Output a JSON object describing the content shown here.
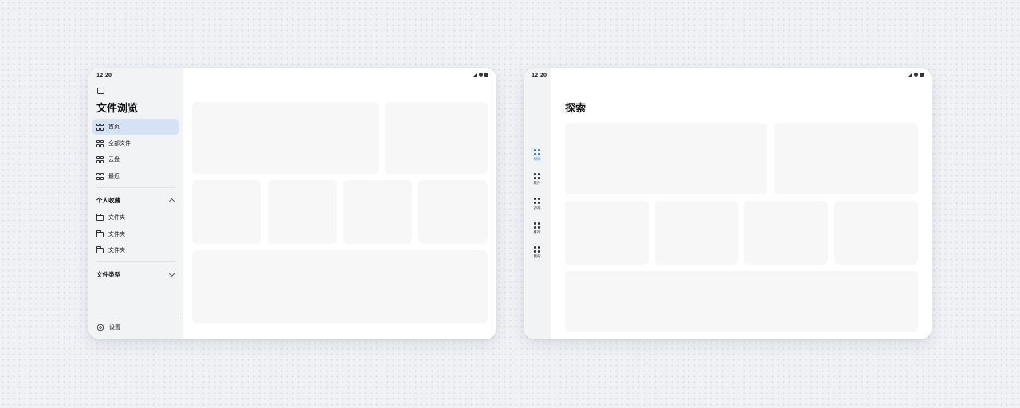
{
  "left_tablet": {
    "status_bar": {
      "time": "12:20"
    },
    "sidebar": {
      "title": "文件浏览",
      "nav_items": [
        {
          "label": "首页",
          "icon": "grid-icon",
          "active": true
        },
        {
          "label": "全部文件",
          "icon": "grid-icon",
          "active": false
        },
        {
          "label": "云盘",
          "icon": "grid-icon",
          "active": false
        },
        {
          "label": "最近",
          "icon": "grid-icon",
          "active": false
        }
      ],
      "favorites": {
        "label": "个人收藏",
        "expanded": true,
        "items": [
          {
            "label": "文件夹",
            "icon": "folder-icon"
          },
          {
            "label": "文件夹",
            "icon": "folder-icon"
          },
          {
            "label": "文件夹",
            "icon": "folder-icon"
          }
        ]
      },
      "file_types": {
        "label": "文件类型",
        "expanded": false
      },
      "settings_label": "设置"
    }
  },
  "right_tablet": {
    "status_bar": {
      "time": "12:20"
    },
    "page_title": "探索",
    "rail_items": [
      {
        "label": "探索",
        "icon": "grid-icon",
        "active": true
      },
      {
        "label": "软件",
        "icon": "grid-icon",
        "active": false
      },
      {
        "label": "游戏",
        "icon": "grid-icon",
        "active": false
      },
      {
        "label": "排行",
        "icon": "grid-icon",
        "active": false
      },
      {
        "label": "我的",
        "icon": "grid-icon",
        "active": false
      }
    ]
  },
  "colors": {
    "accent": "#2f7be6",
    "active_nav_background": "#d5e2f3",
    "sidebar_background": "#f2f3f5",
    "card_placeholder": "#f7f7f8"
  }
}
